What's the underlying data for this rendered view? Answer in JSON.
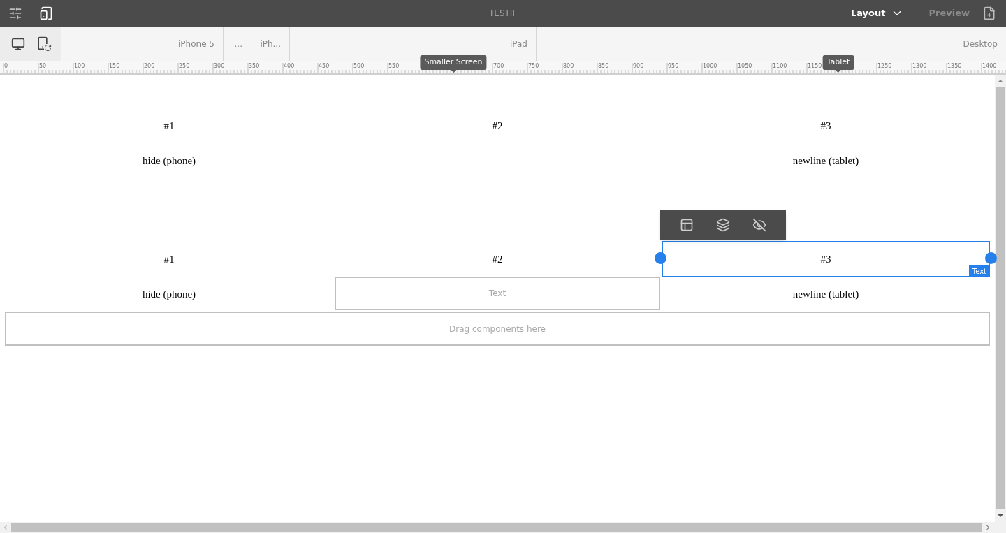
{
  "window": {
    "title": "TESTII"
  },
  "header": {
    "mode": "Layout",
    "preview": "Preview"
  },
  "devices": [
    {
      "label": "iPhone 5"
    },
    {
      "label": "..."
    },
    {
      "label": "iPh..."
    },
    {
      "label": "iPad"
    },
    {
      "label": "Desktop"
    }
  ],
  "ruler": {
    "labels": [
      "0",
      "50",
      "100",
      "150",
      "200",
      "250",
      "300",
      "350",
      "400",
      "450",
      "500",
      "550",
      "700",
      "750",
      "800",
      "850",
      "900",
      "950",
      "1000",
      "1050",
      "1100",
      "1150",
      "1250",
      "1300",
      "1350",
      "1400"
    ],
    "markers": [
      {
        "label": "Smaller Screen"
      },
      {
        "label": "Tablet"
      }
    ]
  },
  "blocks": [
    {
      "rows": [
        [
          {
            "kind": "text",
            "text": "#1",
            "selected": false
          },
          {
            "kind": "text",
            "text": "#2",
            "selected": false
          },
          {
            "kind": "text",
            "text": "#3",
            "selected": false
          }
        ],
        [
          {
            "kind": "text",
            "text": "hide (phone)",
            "selected": false
          },
          {
            "kind": "empty"
          },
          {
            "kind": "text",
            "text": "newline (tablet)",
            "selected": false
          }
        ]
      ]
    },
    {
      "rows": [
        [
          {
            "kind": "text",
            "text": "#1",
            "selected": false
          },
          {
            "kind": "text",
            "text": "#2",
            "selected": false
          },
          {
            "kind": "text",
            "text": "#3",
            "selected": true,
            "badge": "Text"
          }
        ],
        [
          {
            "kind": "text",
            "text": "hide (phone)",
            "selected": false
          },
          {
            "kind": "placeholder",
            "text": "Text"
          },
          {
            "kind": "text",
            "text": "newline (tablet)",
            "selected": false
          }
        ]
      ]
    }
  ],
  "dropzone": {
    "text": "Drag components here"
  }
}
